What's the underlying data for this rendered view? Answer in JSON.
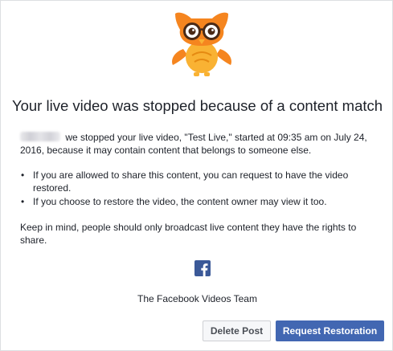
{
  "dialog": {
    "headline": "Your live video was stopped because of a content match",
    "intro": {
      "redacted_name": "",
      "text": "we stopped your live video, \"Test Live,\" started at 09:35 am on July 24, 2016, because it may contain content that belongs to someone else."
    },
    "bullets": [
      "If you are allowed to share this content, you can request to have the video restored.",
      "If you choose to restore the video, the content owner may view it too."
    ],
    "keep_in_mind": "Keep in mind, people should only broadcast live content they have the rights to share.",
    "signature": "The Facebook Videos Team",
    "buttons": {
      "delete": "Delete Post",
      "restore": "Request Restoration"
    }
  },
  "icons": {
    "mascot": "owl-with-glasses-icon",
    "brand": "facebook-f-icon"
  },
  "colors": {
    "owl_orange": "#f5851f",
    "owl_yellow": "#f9b233",
    "facebook_blue": "#3b5998",
    "button_blue": "#4267b2",
    "text": "#1d2129"
  }
}
